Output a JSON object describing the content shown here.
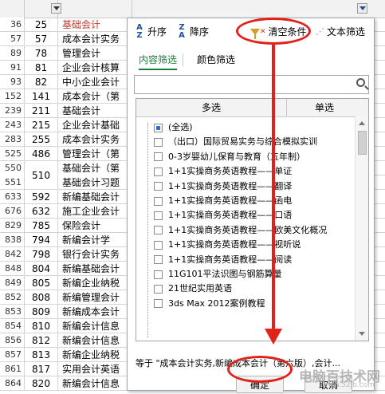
{
  "sheet": {
    "rows": [
      {
        "id": "36",
        "num": "25",
        "name": "基础会计",
        "red": true
      },
      {
        "id": "57",
        "num": "57",
        "name": "成本会计实务"
      },
      {
        "id": "89",
        "num": "78",
        "name": "管理会计"
      },
      {
        "id": "91",
        "num": "81",
        "name": "企业会计核算"
      },
      {
        "id": "93",
        "num": "82",
        "name": "中小企业会计"
      },
      {
        "id": "152",
        "num": "141",
        "name": "成本会计（第"
      },
      {
        "id": "239",
        "num": "211",
        "name": "基础会计"
      },
      {
        "id": "243",
        "num": "215",
        "name": "企业会计基础"
      },
      {
        "id": "283",
        "num": "255",
        "name": "成本会计实务"
      },
      {
        "id": "525",
        "num": "486",
        "name": "管理会计（第"
      },
      {
        "id": "550",
        "num": "510",
        "name": "基础会计（第",
        "name2": "基础会计习题",
        "id2": "551",
        "tall": true
      },
      {
        "id": "633",
        "num": "592",
        "name": "新编基础会计"
      },
      {
        "id": "676",
        "num": "632",
        "name": "施工企业会计"
      },
      {
        "id": "829",
        "num": "785",
        "name": "保险会计"
      },
      {
        "id": "838",
        "num": "794",
        "name": "新编会计学"
      },
      {
        "id": "842",
        "num": "798",
        "name": "银行会计实务"
      },
      {
        "id": "848",
        "num": "804",
        "name": "新编基础会计"
      },
      {
        "id": "849",
        "num": "805",
        "name": "新编企业纳税"
      },
      {
        "id": "852",
        "num": "808",
        "name": "新编管理会计"
      },
      {
        "id": "853",
        "num": "809",
        "name": "新编成本会计"
      },
      {
        "id": "854",
        "num": "810",
        "name": "新编会计信息"
      },
      {
        "id": "856",
        "num": "812",
        "name": "新编会计信息"
      },
      {
        "id": "857",
        "num": "813",
        "name": "新编企业纳税"
      },
      {
        "id": "861",
        "num": "817",
        "name": "实用会计英语"
      },
      {
        "id": "864",
        "num": "820",
        "name": "新编会计信息"
      }
    ]
  },
  "popup": {
    "sort_asc": "升序",
    "sort_desc": "降序",
    "clear_condition": "清空条件",
    "text_filter": "文本筛选",
    "tab_content": "内容筛选",
    "tab_color": "颜色筛选",
    "search_placeholder": "",
    "col_multi": "多选",
    "col_single": "单选",
    "items": [
      {
        "label": "(全选)",
        "state": "partial"
      },
      {
        "label": "（出口）国际贸易实务与综合模拟实训",
        "state": "off"
      },
      {
        "label": "0-3岁婴幼儿保育与教育（五年制）",
        "state": "off"
      },
      {
        "label": "1+1实操商务英语教程——单证",
        "state": "off"
      },
      {
        "label": "1+1实操商务英语教程——翻译",
        "state": "off"
      },
      {
        "label": "1+1实操商务英语教程——函电",
        "state": "off"
      },
      {
        "label": "1+1实操商务英语教程——口语",
        "state": "off"
      },
      {
        "label": "1+1实操商务英语教程——欧美文化概况",
        "state": "off"
      },
      {
        "label": "1+1实操商务英语教程——视听说",
        "state": "off"
      },
      {
        "label": "1+1实操商务英语教程——阅读",
        "state": "off"
      },
      {
        "label": "11G101平法识图与钢筋算量",
        "state": "off"
      },
      {
        "label": "21世纪实用英语",
        "state": "off"
      },
      {
        "label": "3ds Max 2012案例教程",
        "state": "off"
      }
    ],
    "status": "等于 \"成本会计实务,新编成本会计（第六版）,会计...",
    "ok": "确定",
    "cancel": "取消"
  },
  "watermark": "电脑百技术网",
  "watermark_url": "www.52jb.com",
  "colors": {
    "annotation": "#e0231a",
    "tab_active": "#1f7a3a",
    "red_text": "#c0392b"
  }
}
